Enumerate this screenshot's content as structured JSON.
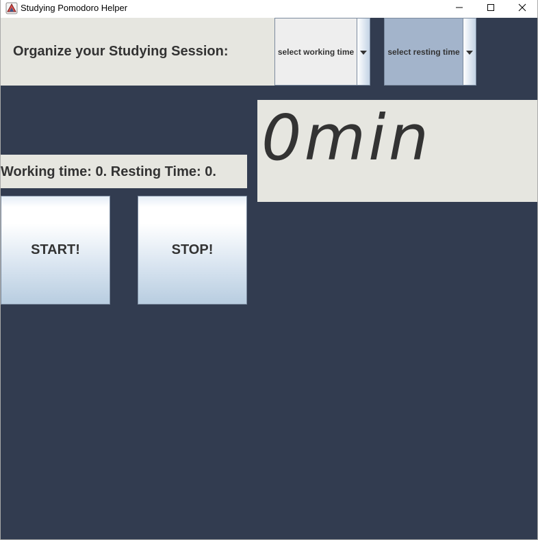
{
  "window": {
    "title": "Studying Pomodoro Helper"
  },
  "header": {
    "label": "Organize your Studying Session:"
  },
  "controls": {
    "working_time_select": {
      "selected": "select working time"
    },
    "resting_time_select": {
      "selected": "select resting time"
    },
    "start_label": "START!",
    "stop_label": "STOP!"
  },
  "timer": {
    "display": "0min"
  },
  "status": {
    "text": "Working time: 0. Resting Time: 0."
  },
  "icons": {
    "app": "java-app-icon",
    "minimize": "minimize-icon",
    "maximize": "maximize-icon",
    "close": "close-icon",
    "dropdown": "chevron-down-icon"
  },
  "colors": {
    "background": "#323c50",
    "panel": "#e6e6e0",
    "text": "#333333",
    "resting_select_bg": "#a3b4cb"
  }
}
